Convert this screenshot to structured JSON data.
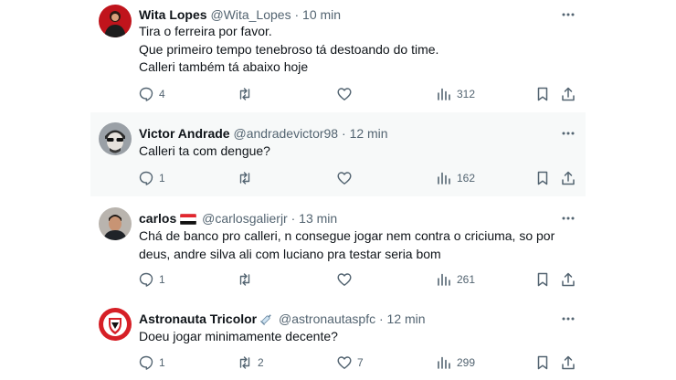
{
  "tweets": [
    {
      "name": "Wita Lopes",
      "handle": "@Wita_Lopes",
      "time": "10 min",
      "lines": [
        "Tira o ferreira por favor.",
        "Que primeiro tempo tenebroso tá destoando do time.",
        "Calleri também tá abaixo hoje"
      ],
      "replies": "4",
      "reposts": "",
      "likes": "",
      "views": "312",
      "avatar": "red-portrait"
    },
    {
      "name": "Victor Andrade",
      "handle": "@andradevictor98",
      "time": "12 min",
      "lines": [
        "Calleri ta com dengue?"
      ],
      "replies": "1",
      "reposts": "",
      "likes": "",
      "views": "162",
      "avatar": "sunglasses-portrait"
    },
    {
      "name": "carlos",
      "handle": "@carlosgalierjr",
      "time": "13 min",
      "lines": [
        "Chá de banco pro calleri, n consegue jogar nem contra o criciuma, so por",
        "deus, andre silva ali com luciano pra testar seria bom"
      ],
      "replies": "1",
      "reposts": "",
      "likes": "",
      "views": "261",
      "avatar": "man-portrait",
      "flag_icon": "sao-paulo-flag-icon"
    },
    {
      "name": "Astronauta Tricolor",
      "handle": "@astronautaspfc",
      "time": "12 min",
      "lines": [
        "Doeu jogar minimamente decente?"
      ],
      "replies": "1",
      "reposts": "2",
      "likes": "7",
      "views": "299",
      "avatar": "spfc-crest",
      "name_icon": "syringe-icon"
    }
  ],
  "separator": "·",
  "colors": {
    "text": "#0f1419",
    "muted": "#536471",
    "highlight": "#f7f9f9",
    "brand_red": "#d61f26"
  }
}
